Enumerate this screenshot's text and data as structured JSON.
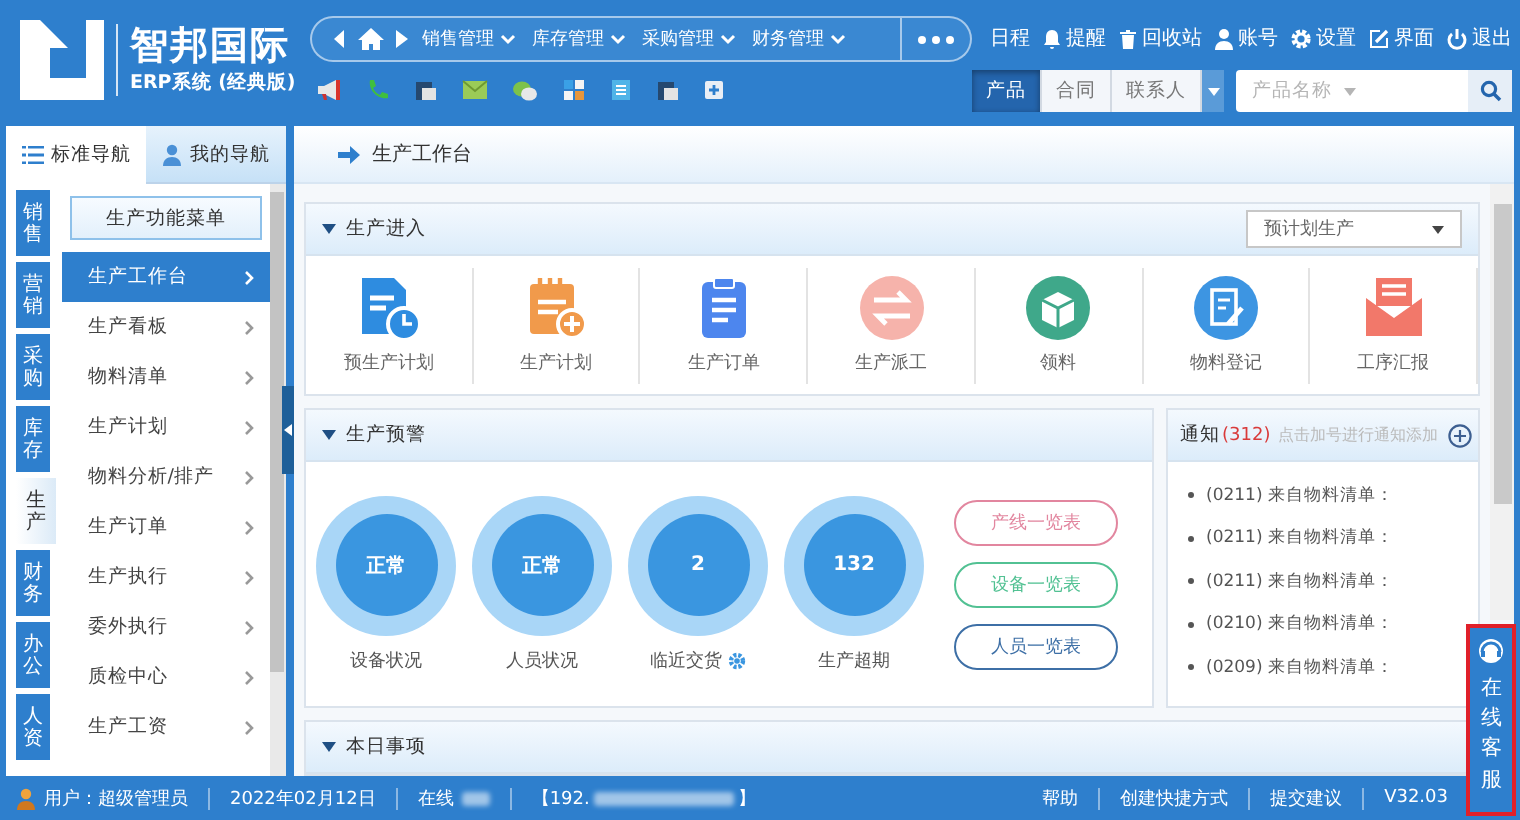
{
  "logo": {
    "title": "智邦国际",
    "subtitle": "ERP系统 (经典版)"
  },
  "nav_menu": [
    {
      "label": "销售管理"
    },
    {
      "label": "库存管理"
    },
    {
      "label": "采购管理"
    },
    {
      "label": "财务管理"
    }
  ],
  "top_links": [
    {
      "label": "日程",
      "kind": "plain"
    },
    {
      "label": "提醒",
      "kind": "bell"
    },
    {
      "label": "回收站",
      "kind": "trash"
    },
    {
      "label": "账号",
      "kind": "user"
    },
    {
      "label": "设置",
      "kind": "gear"
    },
    {
      "label": "界面",
      "kind": "pencil"
    },
    {
      "label": "退出",
      "kind": "power"
    }
  ],
  "search": {
    "tabs": [
      {
        "label": "产品",
        "selected": true
      },
      {
        "label": "合同",
        "selected": false
      },
      {
        "label": "联系人",
        "selected": false
      }
    ],
    "placeholder": "产品名称"
  },
  "sidebar": {
    "tabs": [
      {
        "label": "标准导航",
        "selected": true
      },
      {
        "label": "我的导航",
        "selected": false
      }
    ],
    "categories": [
      {
        "label": "销售",
        "selected": false
      },
      {
        "label": "营销",
        "selected": false
      },
      {
        "label": "采购",
        "selected": false
      },
      {
        "label": "库存",
        "selected": false
      },
      {
        "label": "生产",
        "selected": true
      },
      {
        "label": "财务",
        "selected": false
      },
      {
        "label": "办公",
        "selected": false
      },
      {
        "label": "人资",
        "selected": false
      }
    ],
    "menu_title": "生产功能菜单",
    "items": [
      {
        "label": "生产工作台",
        "selected": true
      },
      {
        "label": "生产看板",
        "selected": false
      },
      {
        "label": "物料清单",
        "selected": false
      },
      {
        "label": "生产计划",
        "selected": false
      },
      {
        "label": "物料分析/排产",
        "selected": false
      },
      {
        "label": "生产订单",
        "selected": false
      },
      {
        "label": "生产执行",
        "selected": false
      },
      {
        "label": "委外执行",
        "selected": false
      },
      {
        "label": "质检中心",
        "selected": false
      },
      {
        "label": "生产工资",
        "selected": false
      }
    ]
  },
  "page_title": "生产工作台",
  "entry_panel": {
    "title": "生产进入",
    "dropdown": "预计划生产",
    "items": [
      {
        "label": "预生产计划",
        "kind": "plan"
      },
      {
        "label": "生产计划",
        "kind": "notepad"
      },
      {
        "label": "生产订单",
        "kind": "clipboard"
      },
      {
        "label": "生产派工",
        "kind": "swap"
      },
      {
        "label": "领料",
        "kind": "box"
      },
      {
        "label": "物料登记",
        "kind": "register"
      },
      {
        "label": "工序汇报",
        "kind": "mail"
      }
    ]
  },
  "warning_panel": {
    "title": "生产预警",
    "gauges": [
      {
        "value": "正常",
        "label": "设备状况",
        "settings": false
      },
      {
        "value": "正常",
        "label": "人员状况",
        "settings": false
      },
      {
        "value": "2",
        "label": "临近交货",
        "settings": true
      },
      {
        "value": "132",
        "label": "生产超期",
        "settings": false
      }
    ],
    "buttons": [
      {
        "label": "产线一览表",
        "color": "#e2869f"
      },
      {
        "label": "设备一览表",
        "color": "#52c193"
      },
      {
        "label": "人员一览表",
        "color": "#3d6fa6"
      }
    ]
  },
  "notice_panel": {
    "title": "通知",
    "count": "(312)",
    "hint": "点击加号进行通知添加",
    "items": [
      "(0211) 来自物料清单：",
      "(0211) 来自物料清单：",
      "(0211) 来自物料清单：",
      "(0210) 来自物料清单：",
      "(0209) 来自物料清单："
    ]
  },
  "today_panel": {
    "title": "本日事项"
  },
  "status_bar": {
    "user": "用户：超级管理员",
    "date": "2022年02月12日",
    "online": "在线",
    "ip_start": "【192.",
    "ip_end": "】",
    "links": [
      "帮助",
      "创建快捷方式",
      "提交建议"
    ],
    "version": "V32.03"
  },
  "service": {
    "label": "在线客服"
  }
}
